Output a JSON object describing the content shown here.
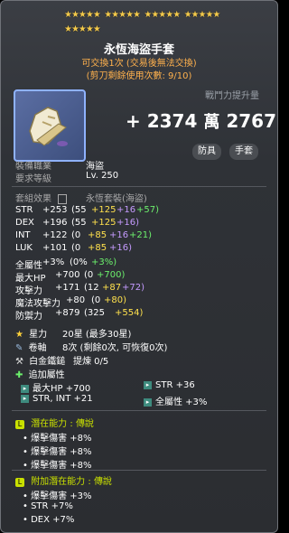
{
  "stars": {
    "row1_count": 20,
    "row2_count": 5,
    "glyph": "★★★★★"
  },
  "item": {
    "name": "永恆海盜手套",
    "trade_note": "可交換1次 (交易後無法交換)",
    "scissor_note": "(剪刀剩餘使用次數: 9/10)",
    "power_label": "戰鬥力提升量",
    "power_value": "+ 2374",
    "power_wan": "萬",
    "power_rest": "2767",
    "category_1": "防具",
    "category_2": "手套"
  },
  "base": {
    "job_label": "裝備職業",
    "job_value": "海盜",
    "level_label": "要求等級",
    "level_value": "Lv. 250",
    "set_label": "套組效果",
    "set_value": "永恆套裝(海盜)"
  },
  "stats": [
    {
      "label": "STR",
      "total": "+253",
      "base": "(55",
      "a": "+125",
      "b": "+16",
      "c": "+57)"
    },
    {
      "label": "DEX",
      "total": "+196",
      "base": "(55",
      "a": "+125",
      "b": "+16)",
      "c": ""
    },
    {
      "label": "INT",
      "total": "+122",
      "base": "(0",
      "a": "+85",
      "b": "+16",
      "c": "+21)"
    },
    {
      "label": "LUK",
      "total": "+101",
      "base": "(0",
      "a": "+85",
      "b": "+16)",
      "c": ""
    }
  ],
  "stats2": {
    "all_label": "全屬性",
    "all_total": "+3%",
    "all_base": "(0%",
    "all_add": "+3%)",
    "hp_label": "最大HP",
    "hp_total": "+700",
    "hp_base": "(0",
    "hp_add": "+700)",
    "att_label": "攻擊力",
    "att_total": "+171",
    "att_base": "(12",
    "att_a": "+87",
    "att_b": "+72)",
    "matt_label": "魔法攻擊力",
    "matt_total": "+80",
    "matt_base": "(0",
    "matt_add": "+80)",
    "def_label": "防禦力",
    "def_total": "+879",
    "def_base": "(325",
    "def_add": "+554)"
  },
  "upgrades": {
    "star_label": "星力",
    "star_value": "20星 (最多30星)",
    "scroll_label": "卷軸",
    "scroll_value": "8次 (剩餘0次, 可恢復0次)",
    "hammer_label": "白金鐵鎚",
    "hammer_value": "提煉 0/5",
    "add_label": "追加屬性",
    "add_1": "最大HP +700",
    "add_2": "STR +36",
    "add_3": "STR, INT +21",
    "add_4": "全屬性 +3%"
  },
  "potential": {
    "label": "潛在能力",
    "grade": "傳說",
    "lines": [
      "爆擊傷害 +8%",
      "爆擊傷害 +8%",
      "爆擊傷害 +8%"
    ]
  },
  "additional": {
    "label": "附加潛在能力",
    "grade": "傳說",
    "lines": [
      "爆擊傷害 +3%",
      "STR +7%",
      "DEX +7%"
    ]
  },
  "colors": {
    "yellow": "#ffe14d",
    "green": "#6cf06c",
    "purple": "#c59bff",
    "legendary": "#c9e000",
    "orange": "#ffb14d"
  }
}
